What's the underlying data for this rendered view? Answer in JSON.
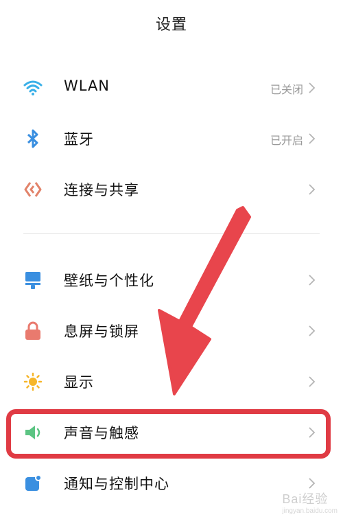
{
  "header": {
    "title": "设置"
  },
  "settings": [
    {
      "label": "WLAN",
      "status": "已关闭",
      "icon": "wifi-icon"
    },
    {
      "label": "蓝牙",
      "status": "已开启",
      "icon": "bluetooth-icon"
    },
    {
      "label": "连接与共享",
      "status": "",
      "icon": "connection-share-icon"
    },
    {
      "label": "壁纸与个性化",
      "status": "",
      "icon": "wallpaper-icon"
    },
    {
      "label": "息屏与锁屏",
      "status": "",
      "icon": "lock-icon"
    },
    {
      "label": "显示",
      "status": "",
      "icon": "brightness-icon"
    },
    {
      "label": "声音与触感",
      "status": "",
      "icon": "speaker-icon"
    },
    {
      "label": "通知与控制中心",
      "status": "",
      "icon": "notification-icon"
    }
  ],
  "annotation": {
    "highlight_color": "#e03b44",
    "arrow_color": "#e8454c"
  },
  "watermark": {
    "text": "Bai经验",
    "sub": "jingyan.baidu.com"
  }
}
